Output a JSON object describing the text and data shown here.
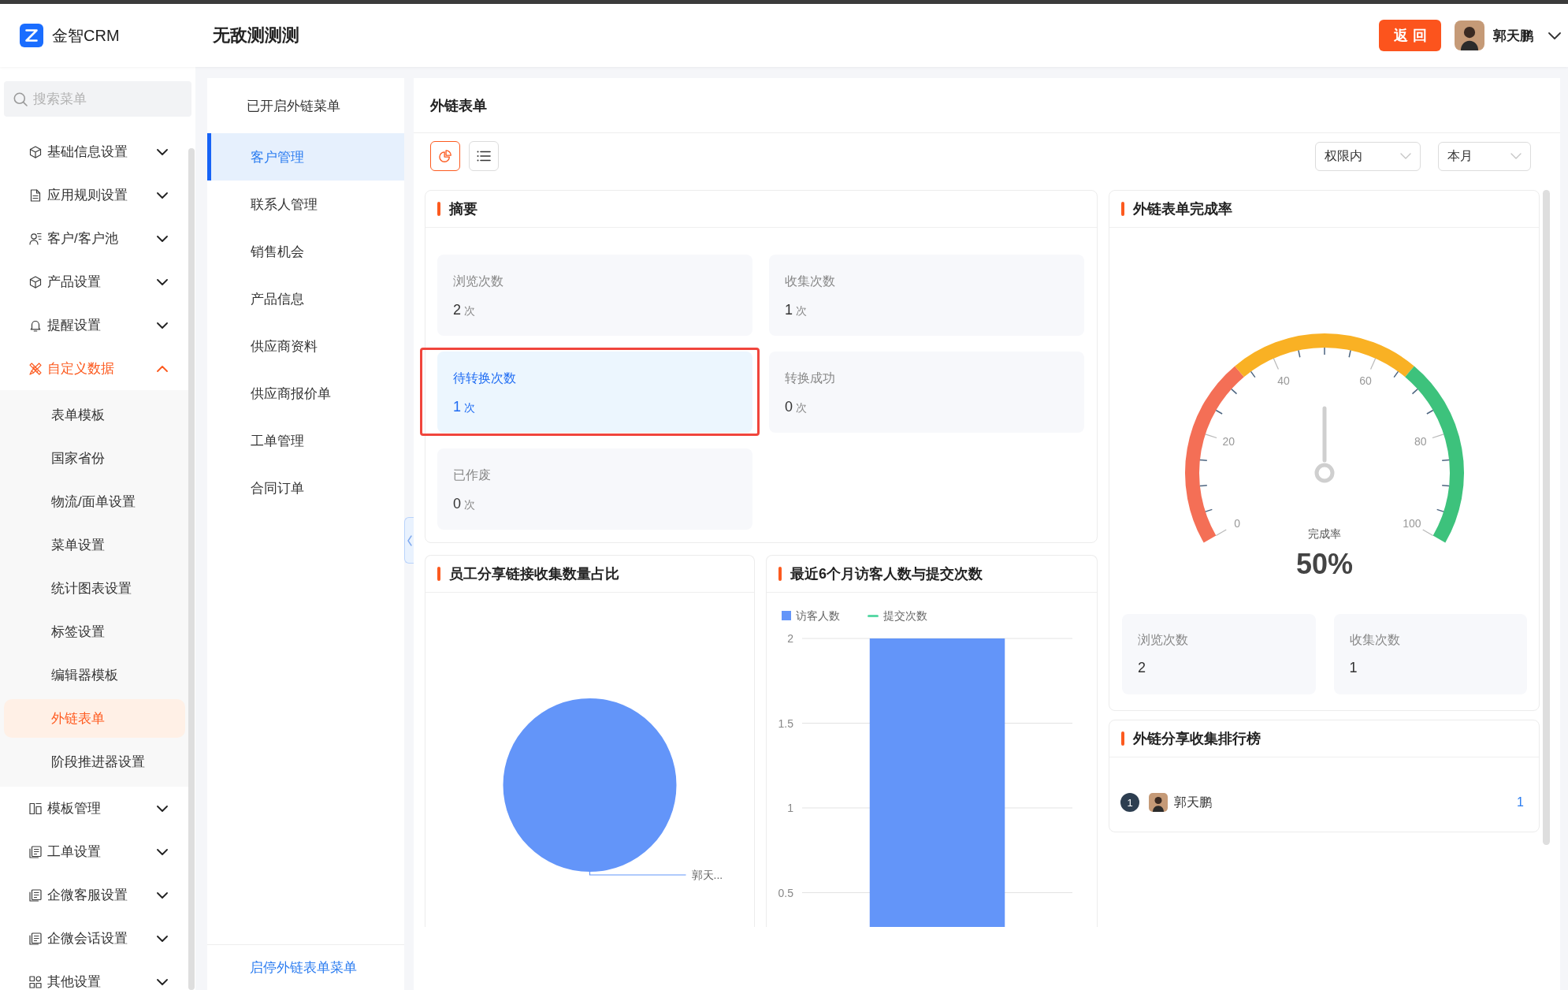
{
  "header": {
    "logo_text": "金智CRM",
    "page_title": "无敌测测测",
    "back_button": "返回",
    "user": {
      "name": "郭天鹏"
    }
  },
  "sidebar": {
    "search": {
      "placeholder": "搜索菜单"
    },
    "items": [
      {
        "label": "基础信息设置",
        "expanded": false
      },
      {
        "label": "应用规则设置",
        "expanded": false
      },
      {
        "label": "客户/客户池",
        "expanded": false
      },
      {
        "label": "产品设置",
        "expanded": false
      },
      {
        "label": "提醒设置",
        "expanded": false
      },
      {
        "label": "自定义数据",
        "expanded": true,
        "children": [
          {
            "label": "表单模板",
            "selected": false
          },
          {
            "label": "国家省份",
            "selected": false
          },
          {
            "label": "物流/面单设置",
            "selected": false
          },
          {
            "label": "菜单设置",
            "selected": false
          },
          {
            "label": "统计图表设置",
            "selected": false
          },
          {
            "label": "标签设置",
            "selected": false
          },
          {
            "label": "编辑器模板",
            "selected": false
          },
          {
            "label": "外链表单",
            "selected": true
          },
          {
            "label": "阶段推进器设置",
            "selected": false
          }
        ]
      },
      {
        "label": "模板管理",
        "expanded": false
      },
      {
        "label": "工单设置",
        "expanded": false
      },
      {
        "label": "企微客服设置",
        "expanded": false
      },
      {
        "label": "企微会话设置",
        "expanded": false
      },
      {
        "label": "其他设置",
        "expanded": false
      }
    ]
  },
  "link_menu": {
    "title": "已开启外链菜单",
    "items": [
      {
        "label": "客户管理",
        "selected": true
      },
      {
        "label": "联系人管理",
        "selected": false
      },
      {
        "label": "销售机会",
        "selected": false
      },
      {
        "label": "产品信息",
        "selected": false
      },
      {
        "label": "供应商资料",
        "selected": false
      },
      {
        "label": "供应商报价单",
        "selected": false
      },
      {
        "label": "工单管理",
        "selected": false
      },
      {
        "label": "合同订单",
        "selected": false
      }
    ],
    "footer_link": "启停外链表单菜单"
  },
  "main": {
    "title": "外链表单",
    "view_buttons": [
      {
        "kind": "chart",
        "selected": true
      },
      {
        "kind": "list",
        "selected": false
      }
    ],
    "filters": [
      {
        "value": "权限内"
      },
      {
        "value": "本月"
      }
    ],
    "summary": {
      "title": "摘要",
      "tiles": [
        {
          "label": "浏览次数",
          "value": "2",
          "unit": "次",
          "selected": false
        },
        {
          "label": "收集次数",
          "value": "1",
          "unit": "次",
          "selected": false
        },
        {
          "label": "待转换次数",
          "value": "1",
          "unit": "次",
          "selected": true
        },
        {
          "label": "转换成功",
          "value": "0",
          "unit": "次",
          "selected": false
        },
        {
          "label": "已作废",
          "value": "0",
          "unit": "次",
          "selected": false
        }
      ]
    },
    "completion": {
      "title": "外链表单完成率",
      "gauge": {
        "scale_labels": [
          "0",
          "20",
          "40",
          "60",
          "80",
          "100"
        ],
        "label": "完成率",
        "reading": "50%",
        "level": 0.5
      },
      "stats": [
        {
          "label": "浏览次数",
          "value": "2"
        },
        {
          "label": "收集次数",
          "value": "1"
        }
      ]
    },
    "ranking": {
      "title": "外链分享收集排行榜",
      "rows": [
        {
          "rank": "1",
          "name": "郭天鹏",
          "count": "1"
        }
      ]
    },
    "share_pie": {
      "title": "员工分享链接收集数量占比",
      "slices": [
        {
          "label": "郭天..."
        }
      ]
    },
    "visits_chart": {
      "title": "最近6个月访客人数与提交次数",
      "chart_data": {
        "type": "bar",
        "series": [
          {
            "name": "访客人数",
            "type": "bar",
            "color": "#6395f9",
            "values": [
              2
            ]
          },
          {
            "name": "提交次数",
            "type": "line",
            "color": "#5ad8a6",
            "values": [
              null
            ]
          }
        ],
        "ylim": [
          0,
          2
        ],
        "yticks": [
          0.5,
          1,
          1.5,
          2
        ],
        "grid": true
      }
    }
  }
}
